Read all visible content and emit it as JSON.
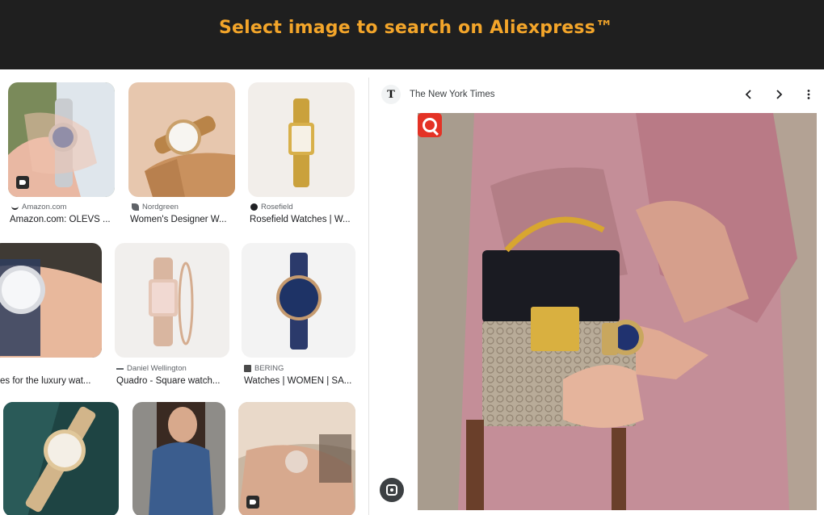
{
  "banner": {
    "title": "Select image to search on Aliexpress™"
  },
  "results": [
    {
      "source": "Amazon.com",
      "title": "Amazon.com: OLEVS ..."
    },
    {
      "source": "Nordgreen",
      "title": "Women's Designer W..."
    },
    {
      "source": "Rosefield",
      "title": "Rosefield Watches | W..."
    },
    {
      "source": "",
      "title": "es for the luxury wat..."
    },
    {
      "source": "Daniel Wellington",
      "title": "Quadro - Square watch..."
    },
    {
      "source": "BERING",
      "title": "Watches | WOMEN | SA..."
    },
    {
      "source": "",
      "title": ""
    },
    {
      "source": "",
      "title": ""
    },
    {
      "source": "",
      "title": ""
    }
  ],
  "panel": {
    "site_name": "The New York Times",
    "logo_letter": "T",
    "back_icon": "chevron-left-icon",
    "forward_icon": "chevron-right-icon",
    "more_icon": "more-vert-icon"
  },
  "colors": {
    "banner_bg": "#1f1f1f",
    "banner_text": "#f3a52a",
    "aliexpress_red": "#e43225"
  }
}
